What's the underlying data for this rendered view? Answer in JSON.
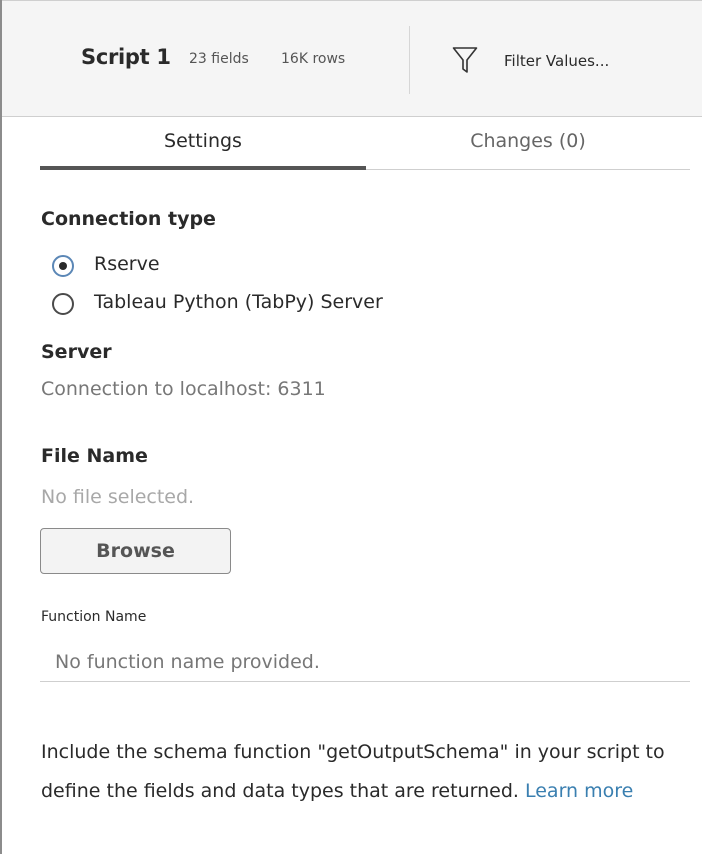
{
  "header": {
    "title": "Script 1",
    "fields": "23 fields",
    "rows": "16K rows",
    "filter_label": "Filter Values...",
    "filter_icon": "filter-icon"
  },
  "tabs": [
    {
      "label": "Settings",
      "active": true
    },
    {
      "label": "Changes (0)",
      "active": false
    }
  ],
  "connection": {
    "heading": "Connection type",
    "options": [
      {
        "label": "Rserve",
        "selected": true
      },
      {
        "label": "Tableau Python (TabPy) Server",
        "selected": false
      }
    ]
  },
  "server": {
    "heading": "Server",
    "value": "Connection to localhost: 6311"
  },
  "file": {
    "heading": "File Name",
    "placeholder": "No file selected.",
    "browse_label": "Browse"
  },
  "function": {
    "label": "Function Name",
    "placeholder": "No function name provided.",
    "value": ""
  },
  "info": {
    "text": "Include the schema function \"getOutputSchema\" in your script to define the fields and data types that are returned.",
    "link_label": "Learn more"
  },
  "colors": {
    "accent": "#5b87b6",
    "link": "#3a7fb0",
    "active_tab": "#555555"
  }
}
